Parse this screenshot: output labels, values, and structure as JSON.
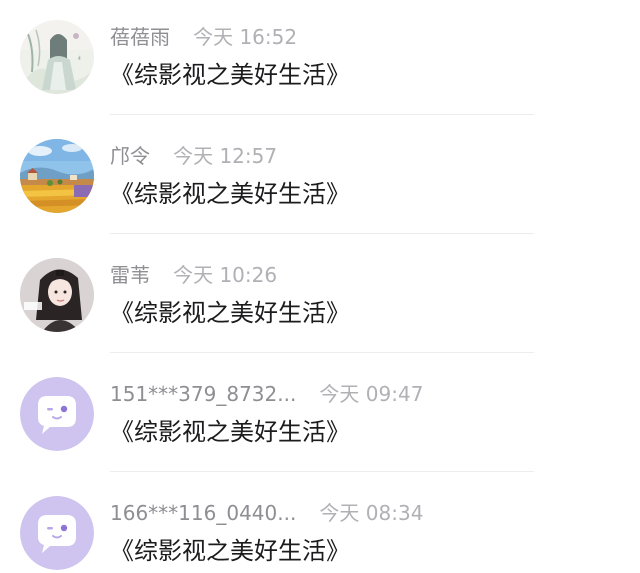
{
  "comments": [
    {
      "avatar": "ink-painting-girl-avatar",
      "name": "蓓蓓雨",
      "time": "今天 16:52",
      "text": "《综影视之美好生活》"
    },
    {
      "avatar": "landscape-painting-avatar",
      "name": "邝令",
      "time": "今天 12:57",
      "text": "《综影视之美好生活》"
    },
    {
      "avatar": "girl-photo-avatar",
      "name": "雷苇",
      "time": "今天 10:26",
      "text": "《综影视之美好生活》"
    },
    {
      "avatar": "default-chat-bubble-avatar",
      "name": "151***379_8732...",
      "time": "今天 09:47",
      "text": "《综影视之美好生活》"
    },
    {
      "avatar": "default-chat-bubble-avatar",
      "name": "166***116_0440...",
      "time": "今天 08:34",
      "text": "《综影视之美好生活》"
    }
  ],
  "colors": {
    "name": "#8e8e93",
    "time": "#b0b0b5",
    "text": "#1c1c1e",
    "default_avatar_bg": "#cfc3ef",
    "divider": "#ededf0"
  }
}
